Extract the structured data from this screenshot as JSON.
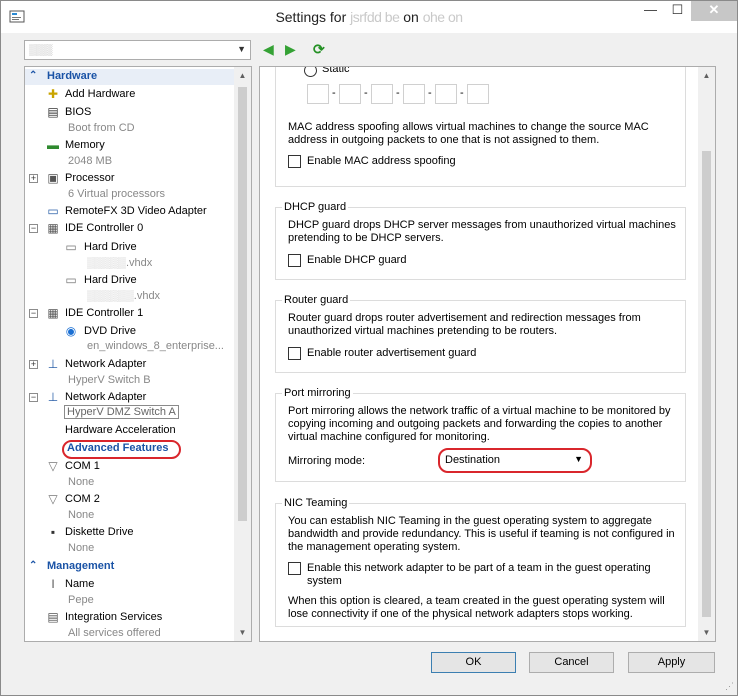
{
  "window": {
    "title_prefix": "Settings for",
    "title_obscured": "jsrfdd be",
    "title_suffix": "on",
    "title_obscured_2": "ohe on",
    "minimize": "—",
    "maximize": "☐",
    "close": "✕"
  },
  "toolbar": {
    "vm_select_value": "▒▒▒",
    "back_icon": "◀",
    "forward_icon": "▶",
    "refresh_icon": "⟳"
  },
  "hardware": {
    "section": "Hardware",
    "items": {
      "add_hardware": "Add Hardware",
      "bios": "BIOS",
      "bios_sub": "Boot from CD",
      "memory": "Memory",
      "memory_sub": "2048 MB",
      "processor": "Processor",
      "processor_sub": "6 Virtual processors",
      "remotefx": "RemoteFX 3D Video Adapter",
      "ide0": "IDE Controller 0",
      "hd1": "Hard Drive",
      "hd1_sub_obscured": "▒▒▒▒▒",
      "hd1_sub_ext": ".vhdx",
      "hd2": "Hard Drive",
      "hd2_sub_obscured": "▒▒▒▒▒▒",
      "hd2_sub_ext": ".vhdx",
      "ide1": "IDE Controller 1",
      "dvd": "DVD Drive",
      "dvd_sub": "en_windows_8_enterprise...",
      "net1": "Network Adapter",
      "net1_sub": "HyperV Switch B",
      "net2": "Network Adapter",
      "net2_sub": "HyperV DMZ Switch A",
      "hw_accel": "Hardware Acceleration",
      "advanced": "Advanced Features",
      "com1": "COM 1",
      "com1_sub": "None",
      "com2": "COM 2",
      "com2_sub": "None",
      "diskette": "Diskette Drive",
      "diskette_sub": "None"
    }
  },
  "management": {
    "section": "Management",
    "items": {
      "name": "Name",
      "name_sub": "Pepe",
      "integration": "Integration Services",
      "integration_sub": "All services offered"
    }
  },
  "advanced": {
    "static_label": "Static",
    "mac_dash": "-",
    "mac_spoof_desc": "MAC address spoofing allows virtual machines to change the source MAC address in outgoing packets to one that is not assigned to them.",
    "mac_spoof_cb": "Enable MAC address spoofing",
    "dhcp_title": "DHCP guard",
    "dhcp_desc": "DHCP guard drops DHCP server messages from unauthorized virtual machines pretending to be DHCP servers.",
    "dhcp_cb": "Enable DHCP guard",
    "router_title": "Router guard",
    "router_desc": "Router guard drops router advertisement and redirection messages from unauthorized virtual machines pretending to be routers.",
    "router_cb": "Enable router advertisement guard",
    "mirror_title": "Port mirroring",
    "mirror_desc": "Port mirroring allows the network traffic of a virtual machine to be monitored by copying incoming and outgoing packets and forwarding the copies to another virtual machine configured for monitoring.",
    "mirror_mode_label": "Mirroring mode:",
    "mirror_mode_value": "Destination",
    "nic_title": "NIC Teaming",
    "nic_desc": "You can establish NIC Teaming in the guest operating system to aggregate bandwidth and provide redundancy. This is useful if teaming is not configured in the management operating system.",
    "nic_cb": "Enable this network adapter to be part of a team in the guest operating system",
    "nic_note": "When this option is cleared, a team created in the guest operating system will lose connectivity if one of the physical network adapters stops working."
  },
  "buttons": {
    "ok": "OK",
    "cancel": "Cancel",
    "apply": "Apply"
  },
  "colors": {
    "accent": "#1a53a6",
    "highlight": "#d9262c",
    "dvd_blue": "#1a6fd3"
  }
}
